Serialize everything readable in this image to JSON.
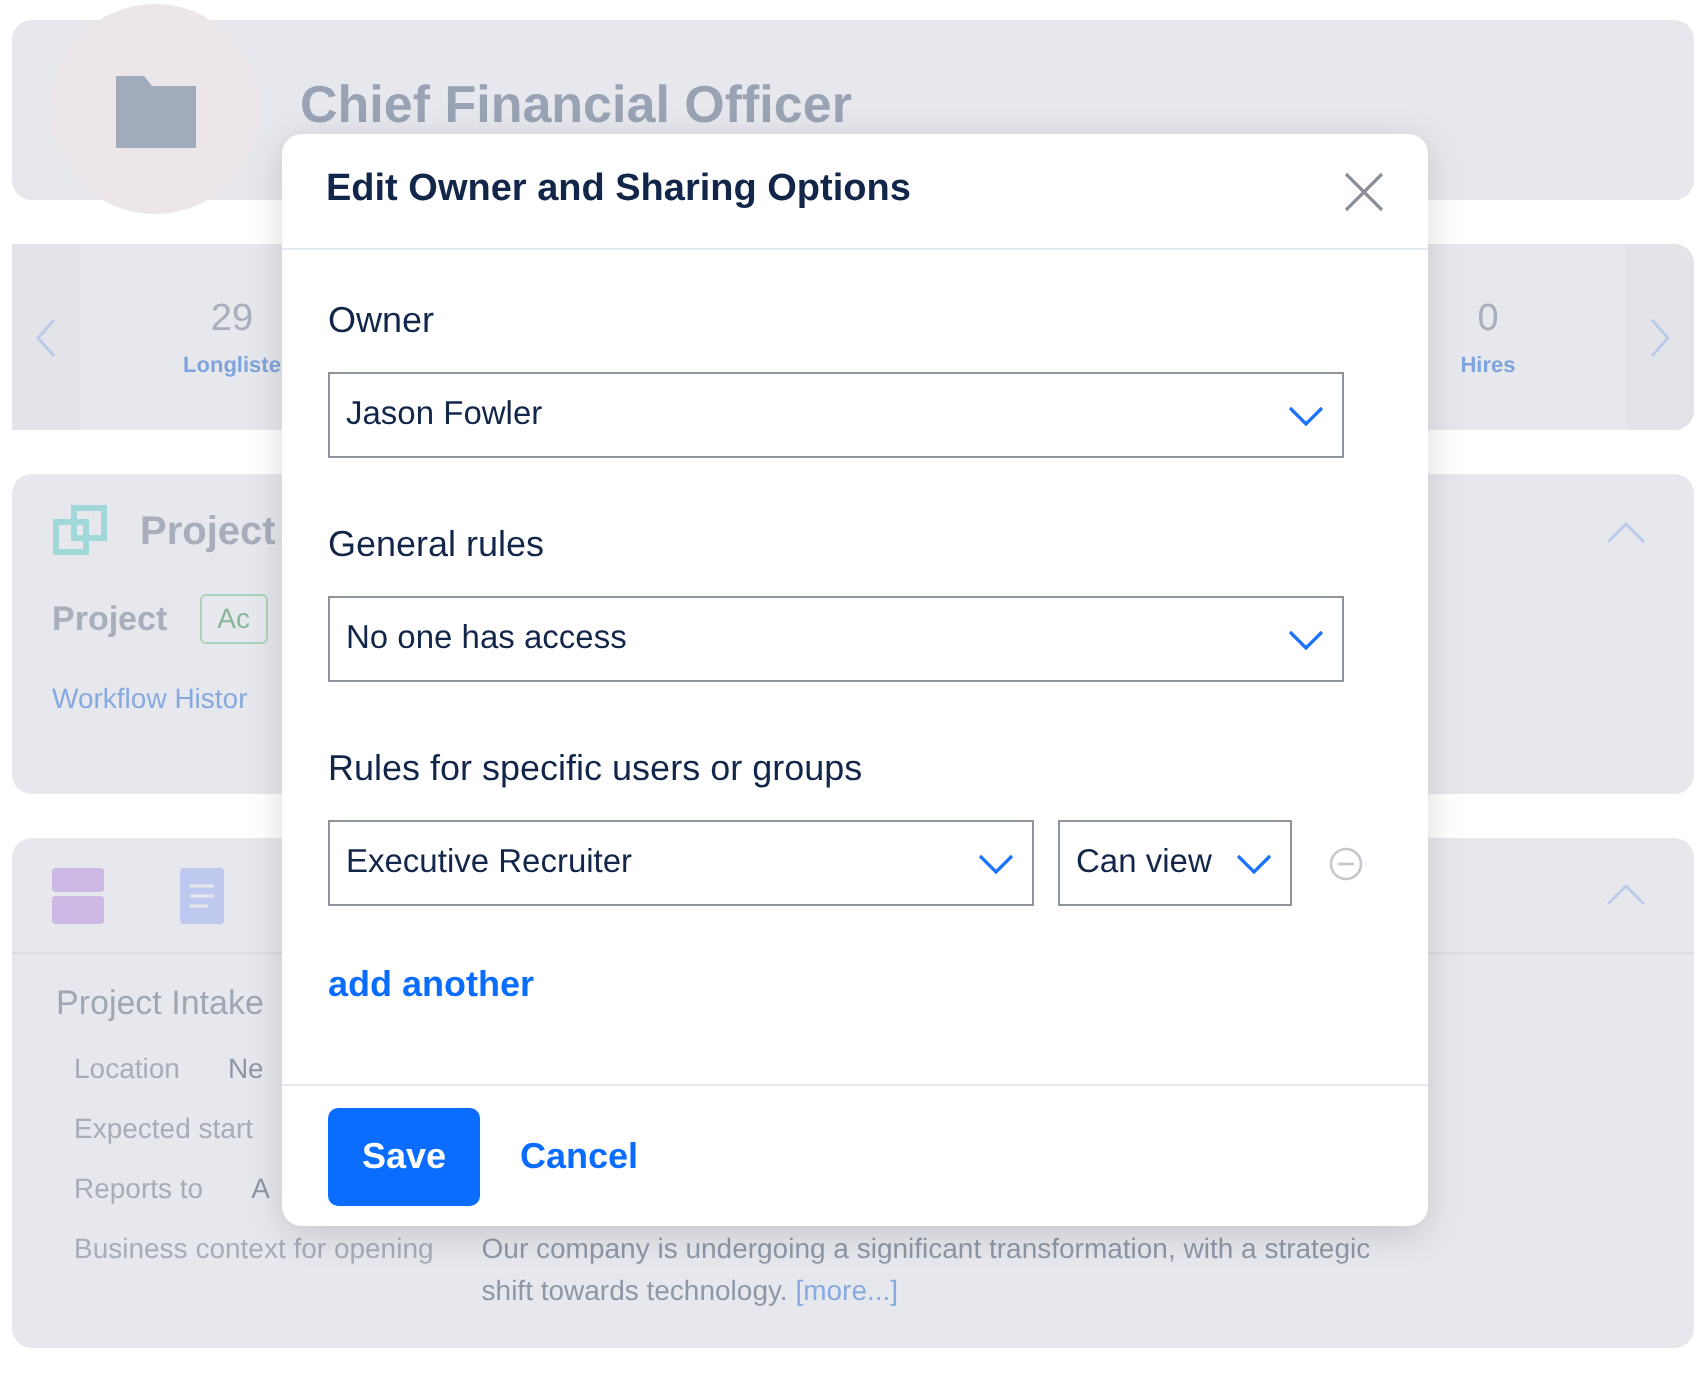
{
  "background": {
    "title": "Chief Financial Officer",
    "stats": [
      {
        "value": "29",
        "label": "Longliste"
      },
      {
        "value": "0",
        "label": "Hires"
      }
    ],
    "project": {
      "title": "Project",
      "field_label": "Project",
      "badge": "Ac",
      "link": "Workflow Histor"
    },
    "intake": {
      "title": "Project Intake",
      "rows": [
        {
          "label": "Location",
          "value": "Ne"
        },
        {
          "label": "Expected start"
        },
        {
          "label": "Reports to",
          "value": "A"
        },
        {
          "label": "Business context for opening",
          "value": "Our company is undergoing a significant transformation, with a strategic shift towards technology.",
          "link": "[more...]"
        }
      ]
    }
  },
  "modal": {
    "title": "Edit Owner and Sharing Options",
    "fields": [
      {
        "label": "Owner",
        "value": "Jason Fowler"
      },
      {
        "label": "General rules",
        "value": "No one has access"
      }
    ],
    "rules": {
      "label": "Rules for specific users or groups",
      "rows": [
        {
          "user": "Executive Recruiter",
          "permission": "Can view"
        }
      ]
    },
    "add_link": "add another",
    "buttons": [
      {
        "label": "Save",
        "kind": "primary"
      },
      {
        "label": "Cancel",
        "kind": "link"
      }
    ]
  }
}
